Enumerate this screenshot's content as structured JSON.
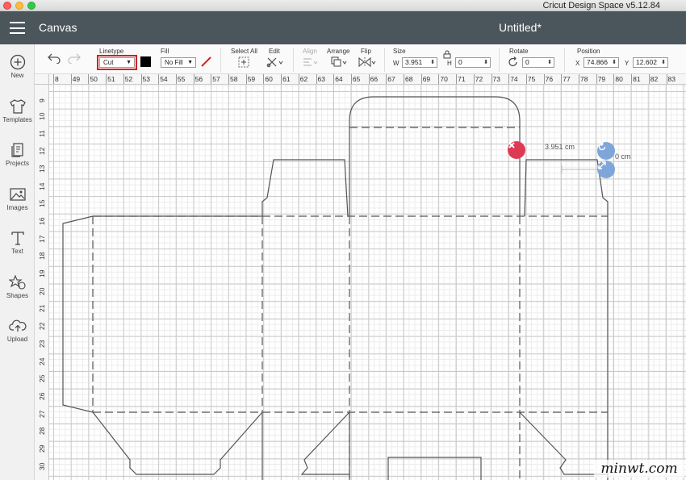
{
  "window": {
    "app_title": "Cricut Design Space  v5.12.84"
  },
  "header": {
    "section": "Canvas",
    "document_title": "Untitled*"
  },
  "sidebar": {
    "items": [
      {
        "label": "New",
        "icon": "plus-circle-icon"
      },
      {
        "label": "Templates",
        "icon": "tshirt-icon"
      },
      {
        "label": "Projects",
        "icon": "projects-icon"
      },
      {
        "label": "Images",
        "icon": "image-icon"
      },
      {
        "label": "Text",
        "icon": "text-t-icon"
      },
      {
        "label": "Shapes",
        "icon": "shapes-icon"
      },
      {
        "label": "Upload",
        "icon": "upload-cloud-icon"
      }
    ]
  },
  "toolbar": {
    "linetype_label": "Linetype",
    "linetype_value": "Cut",
    "fill_label": "Fill",
    "fill_value": "No Fill",
    "select_all_label": "Select All",
    "edit_label": "Edit",
    "align_label": "Align",
    "arrange_label": "Arrange",
    "flip_label": "Flip",
    "size_label": "Size",
    "size_w_prefix": "W",
    "size_w_value": "3.951",
    "size_h_prefix": "H",
    "size_h_value": "0",
    "rotate_label": "Rotate",
    "rotate_value": "0",
    "position_label": "Position",
    "position_x_prefix": "X",
    "position_x_value": "74.866",
    "position_y_prefix": "Y",
    "position_y_value": "12.602",
    "linetype_color": "#000000",
    "highlight_color": "#cc2222"
  },
  "rulers": {
    "top": [
      "8",
      "49",
      "50",
      "51",
      "52",
      "53",
      "54",
      "55",
      "56",
      "57",
      "58",
      "59",
      "60",
      "61",
      "62",
      "63",
      "64",
      "65",
      "66",
      "67",
      "68",
      "69",
      "70",
      "71",
      "72",
      "73",
      "74",
      "75",
      "76",
      "77",
      "78",
      "79",
      "80",
      "81",
      "82",
      "83"
    ],
    "left": [
      "9",
      "10",
      "11",
      "12",
      "13",
      "14",
      "15",
      "16",
      "17",
      "18",
      "19",
      "20",
      "21",
      "22",
      "23",
      "24",
      "25",
      "26",
      "27",
      "28",
      "29",
      "30"
    ]
  },
  "canvas": {
    "width_label": "3.951 cm",
    "height_label": "0 cm",
    "delete_color": "#dd3b54",
    "handle_color": "#7ea6d9"
  },
  "watermark": "minwt.com"
}
